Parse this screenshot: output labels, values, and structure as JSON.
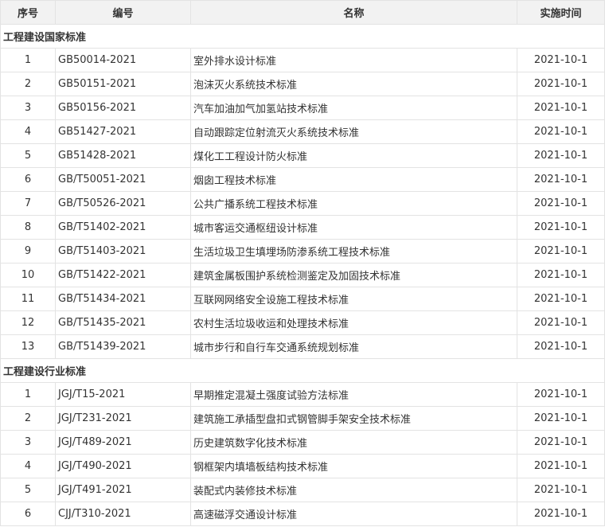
{
  "header": {
    "idx": "序号",
    "code": "编号",
    "name": "名称",
    "date": "实施时间"
  },
  "groups": [
    {
      "title": "工程建设国家标准",
      "rows": [
        {
          "idx": "1",
          "code": "GB50014-2021",
          "name": "室外排水设计标准",
          "date": "2021-10-1"
        },
        {
          "idx": "2",
          "code": "GB50151-2021",
          "name": "泡沫灭火系统技术标准",
          "date": "2021-10-1"
        },
        {
          "idx": "3",
          "code": "GB50156-2021",
          "name": "汽车加油加气加氢站技术标准",
          "date": "2021-10-1"
        },
        {
          "idx": "4",
          "code": "GB51427-2021",
          "name": "自动跟踪定位射流灭火系统技术标准",
          "date": "2021-10-1"
        },
        {
          "idx": "5",
          "code": "GB51428-2021",
          "name": "煤化工工程设计防火标准",
          "date": "2021-10-1"
        },
        {
          "idx": "6",
          "code": "GB/T50051-2021",
          "name": "烟囱工程技术标准",
          "date": "2021-10-1"
        },
        {
          "idx": "7",
          "code": "GB/T50526-2021",
          "name": "公共广播系统工程技术标准",
          "date": "2021-10-1"
        },
        {
          "idx": "8",
          "code": "GB/T51402-2021",
          "name": "城市客运交通枢纽设计标准",
          "date": "2021-10-1"
        },
        {
          "idx": "9",
          "code": "GB/T51403-2021",
          "name": "生活垃圾卫生填埋场防渗系统工程技术标准",
          "date": "2021-10-1"
        },
        {
          "idx": "10",
          "code": "GB/T51422-2021",
          "name": "建筑金属板围护系统检测鉴定及加固技术标准",
          "date": "2021-10-1"
        },
        {
          "idx": "11",
          "code": "GB/T51434-2021",
          "name": "互联网网络安全设施工程技术标准",
          "date": "2021-10-1"
        },
        {
          "idx": "12",
          "code": "GB/T51435-2021",
          "name": "农村生活垃圾收运和处理技术标准",
          "date": "2021-10-1"
        },
        {
          "idx": "13",
          "code": "GB/T51439-2021",
          "name": "城市步行和自行车交通系统规划标准",
          "date": "2021-10-1"
        }
      ]
    },
    {
      "title": "工程建设行业标准",
      "rows": [
        {
          "idx": "1",
          "code": "JGJ/T15-2021",
          "name": "早期推定混凝土强度试验方法标准",
          "date": "2021-10-1"
        },
        {
          "idx": "2",
          "code": "JGJ/T231-2021",
          "name": "建筑施工承插型盘扣式钢管脚手架安全技术标准",
          "date": "2021-10-1"
        },
        {
          "idx": "3",
          "code": "JGJ/T489-2021",
          "name": "历史建筑数字化技术标准",
          "date": "2021-10-1"
        },
        {
          "idx": "4",
          "code": "JGJ/T490-2021",
          "name": "钢框架内填墙板结构技术标准",
          "date": "2021-10-1"
        },
        {
          "idx": "5",
          "code": "JGJ/T491-2021",
          "name": "装配式内装修技术标准",
          "date": "2021-10-1"
        },
        {
          "idx": "6",
          "code": "CJJ/T310-2021",
          "name": "高速磁浮交通设计标准",
          "date": "2021-10-1"
        }
      ]
    }
  ]
}
